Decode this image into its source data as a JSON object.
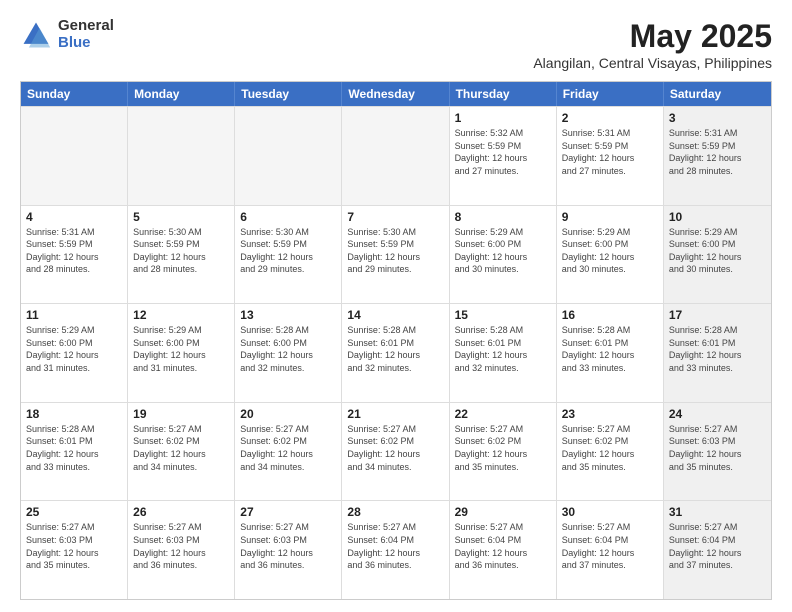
{
  "header": {
    "logo_general": "General",
    "logo_blue": "Blue",
    "month": "May 2025",
    "location": "Alangilan, Central Visayas, Philippines"
  },
  "weekdays": [
    "Sunday",
    "Monday",
    "Tuesday",
    "Wednesday",
    "Thursday",
    "Friday",
    "Saturday"
  ],
  "rows": [
    [
      {
        "day": "",
        "info": "",
        "empty": true
      },
      {
        "day": "",
        "info": "",
        "empty": true
      },
      {
        "day": "",
        "info": "",
        "empty": true
      },
      {
        "day": "",
        "info": "",
        "empty": true
      },
      {
        "day": "1",
        "info": "Sunrise: 5:32 AM\nSunset: 5:59 PM\nDaylight: 12 hours\nand 27 minutes.",
        "empty": false
      },
      {
        "day": "2",
        "info": "Sunrise: 5:31 AM\nSunset: 5:59 PM\nDaylight: 12 hours\nand 27 minutes.",
        "empty": false
      },
      {
        "day": "3",
        "info": "Sunrise: 5:31 AM\nSunset: 5:59 PM\nDaylight: 12 hours\nand 28 minutes.",
        "empty": false,
        "shaded": true
      }
    ],
    [
      {
        "day": "4",
        "info": "Sunrise: 5:31 AM\nSunset: 5:59 PM\nDaylight: 12 hours\nand 28 minutes.",
        "empty": false
      },
      {
        "day": "5",
        "info": "Sunrise: 5:30 AM\nSunset: 5:59 PM\nDaylight: 12 hours\nand 28 minutes.",
        "empty": false
      },
      {
        "day": "6",
        "info": "Sunrise: 5:30 AM\nSunset: 5:59 PM\nDaylight: 12 hours\nand 29 minutes.",
        "empty": false
      },
      {
        "day": "7",
        "info": "Sunrise: 5:30 AM\nSunset: 5:59 PM\nDaylight: 12 hours\nand 29 minutes.",
        "empty": false
      },
      {
        "day": "8",
        "info": "Sunrise: 5:29 AM\nSunset: 6:00 PM\nDaylight: 12 hours\nand 30 minutes.",
        "empty": false
      },
      {
        "day": "9",
        "info": "Sunrise: 5:29 AM\nSunset: 6:00 PM\nDaylight: 12 hours\nand 30 minutes.",
        "empty": false
      },
      {
        "day": "10",
        "info": "Sunrise: 5:29 AM\nSunset: 6:00 PM\nDaylight: 12 hours\nand 30 minutes.",
        "empty": false,
        "shaded": true
      }
    ],
    [
      {
        "day": "11",
        "info": "Sunrise: 5:29 AM\nSunset: 6:00 PM\nDaylight: 12 hours\nand 31 minutes.",
        "empty": false
      },
      {
        "day": "12",
        "info": "Sunrise: 5:29 AM\nSunset: 6:00 PM\nDaylight: 12 hours\nand 31 minutes.",
        "empty": false
      },
      {
        "day": "13",
        "info": "Sunrise: 5:28 AM\nSunset: 6:00 PM\nDaylight: 12 hours\nand 32 minutes.",
        "empty": false
      },
      {
        "day": "14",
        "info": "Sunrise: 5:28 AM\nSunset: 6:01 PM\nDaylight: 12 hours\nand 32 minutes.",
        "empty": false
      },
      {
        "day": "15",
        "info": "Sunrise: 5:28 AM\nSunset: 6:01 PM\nDaylight: 12 hours\nand 32 minutes.",
        "empty": false
      },
      {
        "day": "16",
        "info": "Sunrise: 5:28 AM\nSunset: 6:01 PM\nDaylight: 12 hours\nand 33 minutes.",
        "empty": false
      },
      {
        "day": "17",
        "info": "Sunrise: 5:28 AM\nSunset: 6:01 PM\nDaylight: 12 hours\nand 33 minutes.",
        "empty": false,
        "shaded": true
      }
    ],
    [
      {
        "day": "18",
        "info": "Sunrise: 5:28 AM\nSunset: 6:01 PM\nDaylight: 12 hours\nand 33 minutes.",
        "empty": false
      },
      {
        "day": "19",
        "info": "Sunrise: 5:27 AM\nSunset: 6:02 PM\nDaylight: 12 hours\nand 34 minutes.",
        "empty": false
      },
      {
        "day": "20",
        "info": "Sunrise: 5:27 AM\nSunset: 6:02 PM\nDaylight: 12 hours\nand 34 minutes.",
        "empty": false
      },
      {
        "day": "21",
        "info": "Sunrise: 5:27 AM\nSunset: 6:02 PM\nDaylight: 12 hours\nand 34 minutes.",
        "empty": false
      },
      {
        "day": "22",
        "info": "Sunrise: 5:27 AM\nSunset: 6:02 PM\nDaylight: 12 hours\nand 35 minutes.",
        "empty": false
      },
      {
        "day": "23",
        "info": "Sunrise: 5:27 AM\nSunset: 6:02 PM\nDaylight: 12 hours\nand 35 minutes.",
        "empty": false
      },
      {
        "day": "24",
        "info": "Sunrise: 5:27 AM\nSunset: 6:03 PM\nDaylight: 12 hours\nand 35 minutes.",
        "empty": false,
        "shaded": true
      }
    ],
    [
      {
        "day": "25",
        "info": "Sunrise: 5:27 AM\nSunset: 6:03 PM\nDaylight: 12 hours\nand 35 minutes.",
        "empty": false
      },
      {
        "day": "26",
        "info": "Sunrise: 5:27 AM\nSunset: 6:03 PM\nDaylight: 12 hours\nand 36 minutes.",
        "empty": false
      },
      {
        "day": "27",
        "info": "Sunrise: 5:27 AM\nSunset: 6:03 PM\nDaylight: 12 hours\nand 36 minutes.",
        "empty": false
      },
      {
        "day": "28",
        "info": "Sunrise: 5:27 AM\nSunset: 6:04 PM\nDaylight: 12 hours\nand 36 minutes.",
        "empty": false
      },
      {
        "day": "29",
        "info": "Sunrise: 5:27 AM\nSunset: 6:04 PM\nDaylight: 12 hours\nand 36 minutes.",
        "empty": false
      },
      {
        "day": "30",
        "info": "Sunrise: 5:27 AM\nSunset: 6:04 PM\nDaylight: 12 hours\nand 37 minutes.",
        "empty": false
      },
      {
        "day": "31",
        "info": "Sunrise: 5:27 AM\nSunset: 6:04 PM\nDaylight: 12 hours\nand 37 minutes.",
        "empty": false,
        "shaded": true
      }
    ]
  ]
}
